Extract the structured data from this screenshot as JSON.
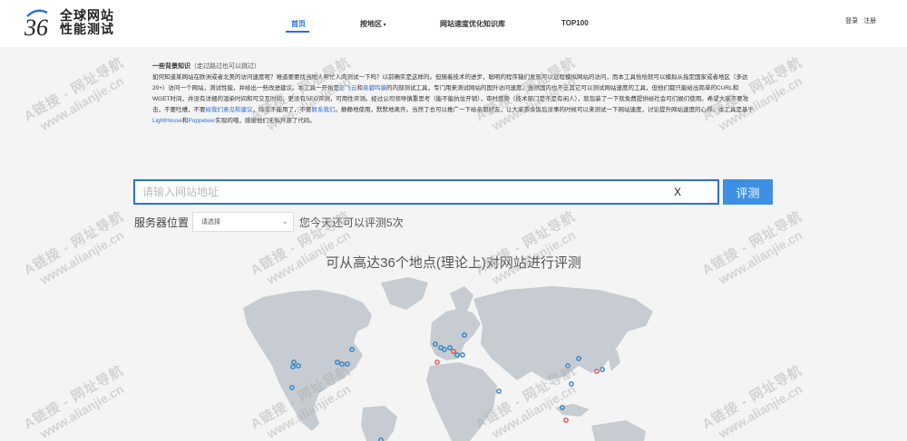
{
  "header": {
    "logo_mark": "36",
    "logo_line1": "全球网站",
    "logo_line2": "性能测试",
    "nav": [
      {
        "label": "首页",
        "active": true
      },
      {
        "label": "按地区",
        "dropdown": true
      },
      {
        "label": "网站速度优化知识库"
      },
      {
        "label": "TOP100"
      }
    ],
    "login": "登录",
    "register": "注册"
  },
  "intro": {
    "title": "一些背景知识",
    "title_note": "（走过路过也可以跳过）",
    "p1": "如何知道某网站在欧洲或者北美的访问速度呢？难道要要找当地人帮忙人肉测试一下吗？以前确实是这样的。但随着技术的进步，聪明的程序猿们发现可以远程模拟网站的访问，而本工具恰恰就可以模拟从指定国家或者地区（多达20+）访问一个网站，测试性能，并给出一些改进建议。本工具一开始是",
    "link1": "彭飞云",
    "p2": "和",
    "link2": "袁碧鸣猿",
    "p3": "的内部测试工具，专门用来测试网站的国外访问速度。虽然国内也不乏其它可以测试网站速度的工具，但他们都只能给出简单的CURL和WGET时间，并没有详细的渲染时间和可交互时间，更没有SEO评测，可用性评测。经过公司领导慎重思考（能不能抗住开销），审时度势（技术部门是不是有闲人），就包装了一下就免费提供给社会可们娱们使用。希望大家不要攻击，不要吐槽，不要",
    "link3": "给我们意见和建议",
    "p4": "，除非不能用了，不要",
    "link4": "联系我们",
    "p5": "。静静地使用，默默地离开。当然了也可以推广一下给亲朋好友，让大家茶余饭后没事的时候可以来测试一下网站速度，讨论提升网站速度的心得。本工具是基于",
    "link5": "LightHouse",
    "p6": "和",
    "link6": "Puppeteer",
    "p7": "实现的哦，感谢他们无私开源了代码。"
  },
  "search": {
    "placeholder": "请输入网站地址",
    "clear": "X",
    "submit": "评测"
  },
  "server": {
    "label": "服务器位置",
    "select_value": "请选择",
    "quota": "您今天还可以评测5次"
  },
  "map_title": "可从高达36个地点(理论上)对网站进行评测",
  "colors": {
    "accent": "#2b6fd6",
    "button": "#3d8fe3",
    "marker_blue": "#2b82c9",
    "marker_red": "#d9534f",
    "land": "#c6ccd1"
  },
  "watermark": {
    "line1": "A链接 - 网址导航",
    "line2": "www.alianjie.cn"
  }
}
